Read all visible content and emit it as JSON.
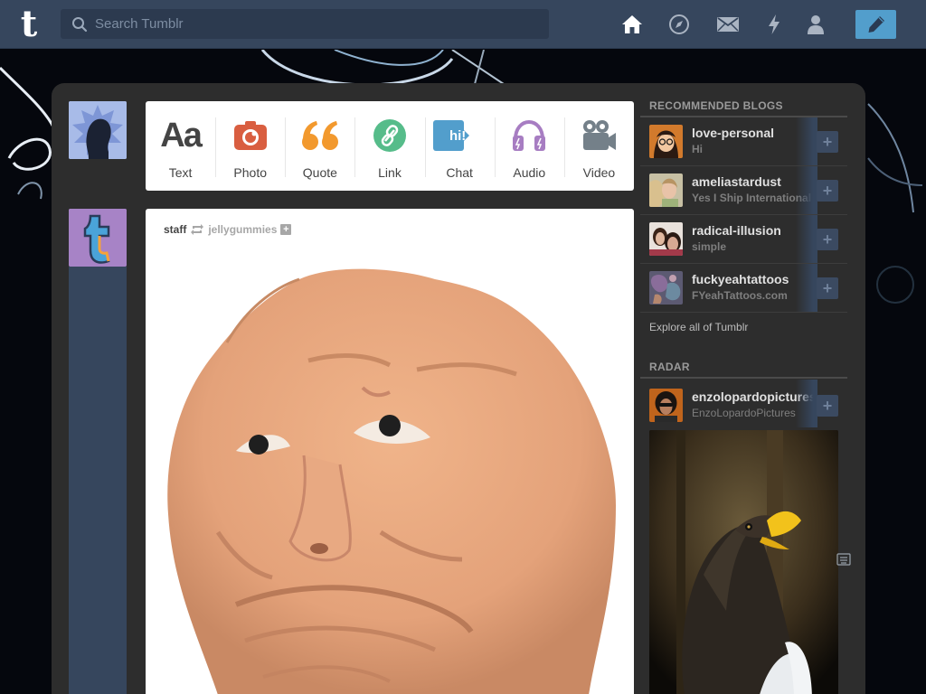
{
  "header": {
    "logo": "t",
    "search_placeholder": "Search Tumblr",
    "nav": [
      {
        "icon": "home-icon"
      },
      {
        "icon": "explore-compass-icon"
      },
      {
        "icon": "inbox-envelope-icon"
      },
      {
        "icon": "activity-lightning-icon"
      },
      {
        "icon": "account-person-icon"
      }
    ],
    "compose_icon": "pencil-icon"
  },
  "post_types": [
    {
      "label": "Text",
      "icon": "text-aa-icon",
      "color": "#444444"
    },
    {
      "label": "Photo",
      "icon": "camera-icon",
      "color": "#d95e40"
    },
    {
      "label": "Quote",
      "icon": "quote-icon",
      "color": "#f2992e"
    },
    {
      "label": "Link",
      "icon": "link-icon",
      "color": "#56bc8a"
    },
    {
      "label": "Chat",
      "icon": "chat-bubble-icon",
      "color": "#529ecc"
    },
    {
      "label": "Audio",
      "icon": "headphones-icon",
      "color": "#a77dc2"
    },
    {
      "label": "Video",
      "icon": "video-camera-icon",
      "color": "#748089"
    }
  ],
  "post": {
    "author": "staff",
    "reblog_icon": "reblog-icon",
    "source": "jellygummies",
    "follow_icon": "plus-icon",
    "chat_icon_text": "hi!",
    "text_icon_text": "Aa"
  },
  "sidebar": {
    "recommended_heading": "RECOMMENDED BLOGS",
    "recommended": [
      {
        "name": "love-personal",
        "title": "Hi"
      },
      {
        "name": "ameliastardust",
        "title": "Yes I Ship International"
      },
      {
        "name": "radical-illusion",
        "title": "simple"
      },
      {
        "name": "fuckyeahtattoos",
        "title": "FYeahTattoos.com"
      }
    ],
    "explore_link": "Explore all of Tumblr",
    "radar_heading": "RADAR",
    "radar": {
      "name": "enzolopardopictures",
      "title": "EnzoLopardoPictures"
    },
    "follow_label": "+"
  },
  "colors": {
    "header": "#36465d",
    "compose": "#529ecc",
    "panel": "#2d2d2d"
  }
}
